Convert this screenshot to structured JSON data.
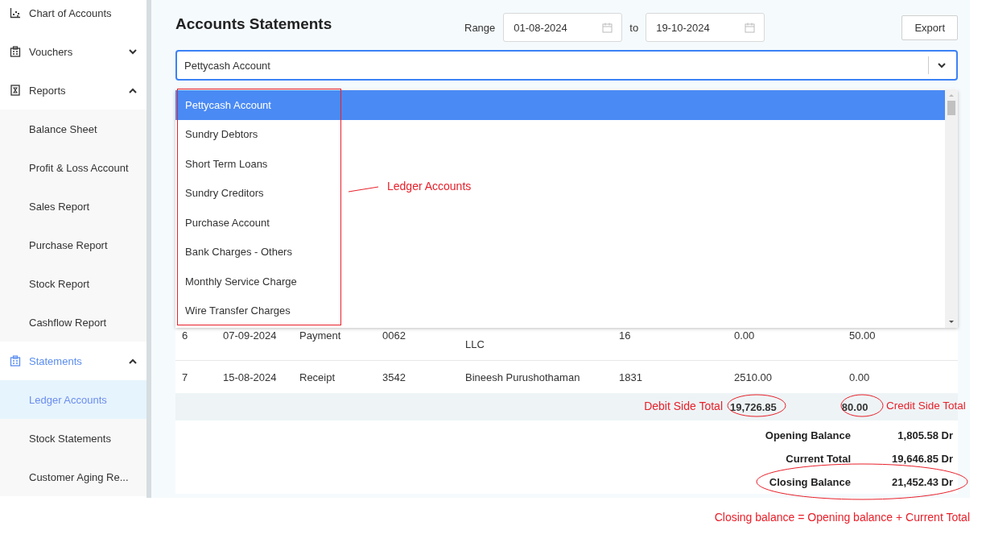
{
  "sidebar": {
    "items": [
      {
        "label": "Chart of Accounts",
        "kind": "link",
        "selected": false
      },
      {
        "label": "Vouchers",
        "kind": "group",
        "expanded": false,
        "selected": false
      },
      {
        "label": "Reports",
        "kind": "group",
        "expanded": true,
        "selected": false,
        "children": [
          {
            "label": "Balance Sheet",
            "selected": false
          },
          {
            "label": "Profit & Loss Account",
            "selected": false
          },
          {
            "label": "Sales Report",
            "selected": false
          },
          {
            "label": "Purchase Report",
            "selected": false
          },
          {
            "label": "Stock Report",
            "selected": false
          },
          {
            "label": "Cashflow Report",
            "selected": false
          }
        ]
      },
      {
        "label": "Statements",
        "kind": "group",
        "expanded": true,
        "selected": true,
        "children": [
          {
            "label": "Ledger Accounts",
            "selected": true
          },
          {
            "label": "Stock Statements",
            "selected": false
          },
          {
            "label": "Customer Aging Re...",
            "selected": false
          }
        ]
      }
    ]
  },
  "header": {
    "title": "Accounts Statements",
    "range_label": "Range",
    "from": "01-08-2024",
    "to_label": "to",
    "to": "19-10-2024",
    "export_button": "Export"
  },
  "account_select": {
    "value": "Pettycash Account",
    "expanded": true,
    "options": [
      {
        "label": "Pettycash Account",
        "selected": true
      },
      {
        "label": "Sundry Debtors",
        "selected": false
      },
      {
        "label": "Short Term Loans",
        "selected": false
      },
      {
        "label": "Sundry Creditors",
        "selected": false
      },
      {
        "label": "Purchase Account",
        "selected": false
      },
      {
        "label": "Bank Charges - Others",
        "selected": false
      },
      {
        "label": "Monthly Service Charge",
        "selected": false
      },
      {
        "label": "Wire Transfer Charges",
        "selected": false
      }
    ]
  },
  "table": {
    "rows": [
      {
        "cells": [
          "6",
          "07-09-2024",
          "Payment",
          "0062",
          "LLC",
          "16",
          "0.00",
          "50.00"
        ]
      },
      {
        "cells": [
          "7",
          "15-08-2024",
          "Receipt",
          "3542",
          "Bineesh Purushothaman",
          "1831",
          "2510.00",
          "0.00"
        ]
      }
    ],
    "totals": {
      "debit": "19,726.85",
      "credit": "80.00"
    },
    "summary": [
      {
        "label": "Opening Balance",
        "value": "1,805.58 Dr"
      },
      {
        "label": "Current Total",
        "value": "19,646.85 Dr"
      },
      {
        "label": "Closing Balance",
        "value": "21,452.43 Dr"
      }
    ]
  },
  "annotations": {
    "list_note": "Ledger Accounts",
    "debit_note": "Debit Side Total",
    "credit_note": "Credit Side Total",
    "formula_note": "Closing balance = Opening balance + Current Total"
  }
}
